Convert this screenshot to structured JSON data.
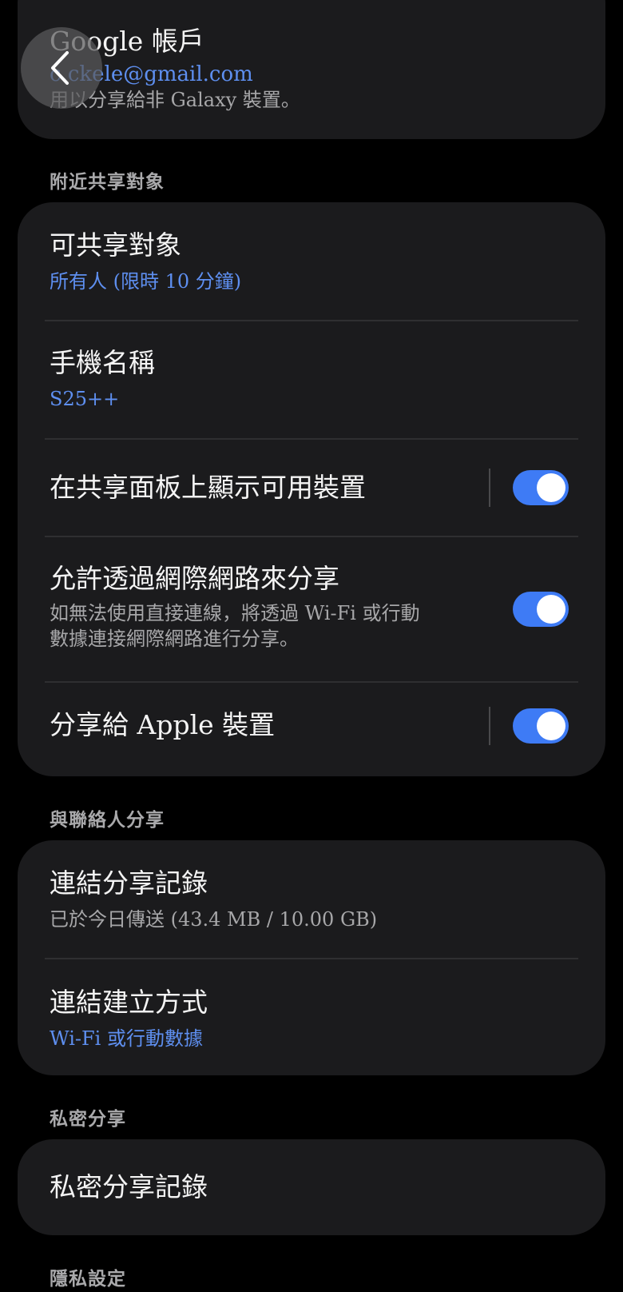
{
  "google_account": {
    "title": "Google 帳戶",
    "email": "c.ckele@gmail.com",
    "description": "用以分享給非 Galaxy 裝置。"
  },
  "nearby": {
    "section_label": "附近共享對象",
    "who_can_share": {
      "title": "可共享對象",
      "value": "所有人 (限時 10 分鐘)"
    },
    "phone_name": {
      "title": "手機名稱",
      "value": "S25++"
    },
    "show_on_panel": {
      "title": "在共享面板上顯示可用裝置",
      "enabled": true
    },
    "share_via_internet": {
      "title": "允許透過網際網路來分享",
      "desc_line1": "如無法使用直接連線，將透過 Wi-Fi 或行動",
      "desc_line2": "數據連接網際網路進行分享。",
      "enabled": true
    },
    "share_to_apple": {
      "title": "分享給 Apple 裝置",
      "enabled": true
    }
  },
  "contacts": {
    "section_label": "與聯絡人分享",
    "link_history": {
      "title": "連結分享記錄",
      "value": "已於今日傳送 (43.4 MB / 10.00 GB)"
    },
    "link_method": {
      "title": "連結建立方式",
      "value": "Wi-Fi 或行動數據"
    }
  },
  "private": {
    "section_label": "私密分享",
    "history": {
      "title": "私密分享記錄"
    }
  },
  "privacy": {
    "section_label": "隱私設定"
  },
  "icons": {
    "back": "chevron-left-icon"
  },
  "colors": {
    "accent": "#3e7bf5",
    "link": "#5e8ff0",
    "card": "#1b1b1d",
    "background": "#000000"
  }
}
